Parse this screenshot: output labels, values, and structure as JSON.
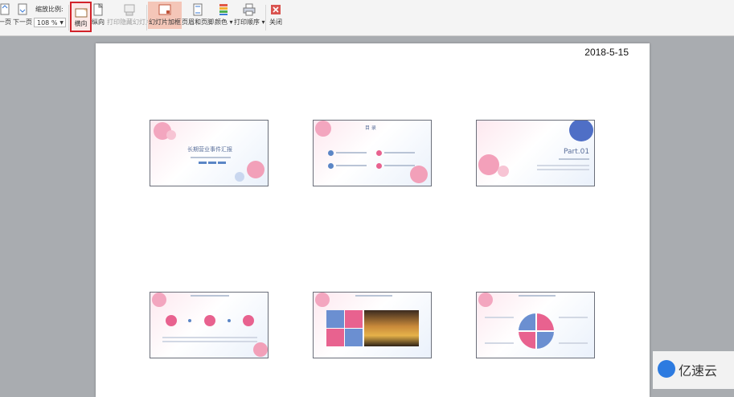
{
  "toolbar": {
    "prev_label": "一页",
    "next_label": "下一页",
    "zoom_label": "缩放比例:",
    "zoom_value": "108 %",
    "landscape_label": "横向",
    "portrait_label": "纵向",
    "print_hidden_label": "打印隐藏幻灯片",
    "frame_label": "幻灯片加框",
    "header_footer_label": "页眉和页脚",
    "color_label": "颜色",
    "print_order_label": "打印顺序",
    "close_label": "关闭"
  },
  "page": {
    "date": "2018-5-15"
  },
  "slides": {
    "s1_title": "长期营业事件汇报",
    "s2_title": "目 录",
    "s3_title": "Part.01"
  },
  "watermark": {
    "text": "亿速云"
  },
  "colors": {
    "accent_red": "#d2232a",
    "pink": "#e8628f",
    "blue": "#5b86c6"
  }
}
